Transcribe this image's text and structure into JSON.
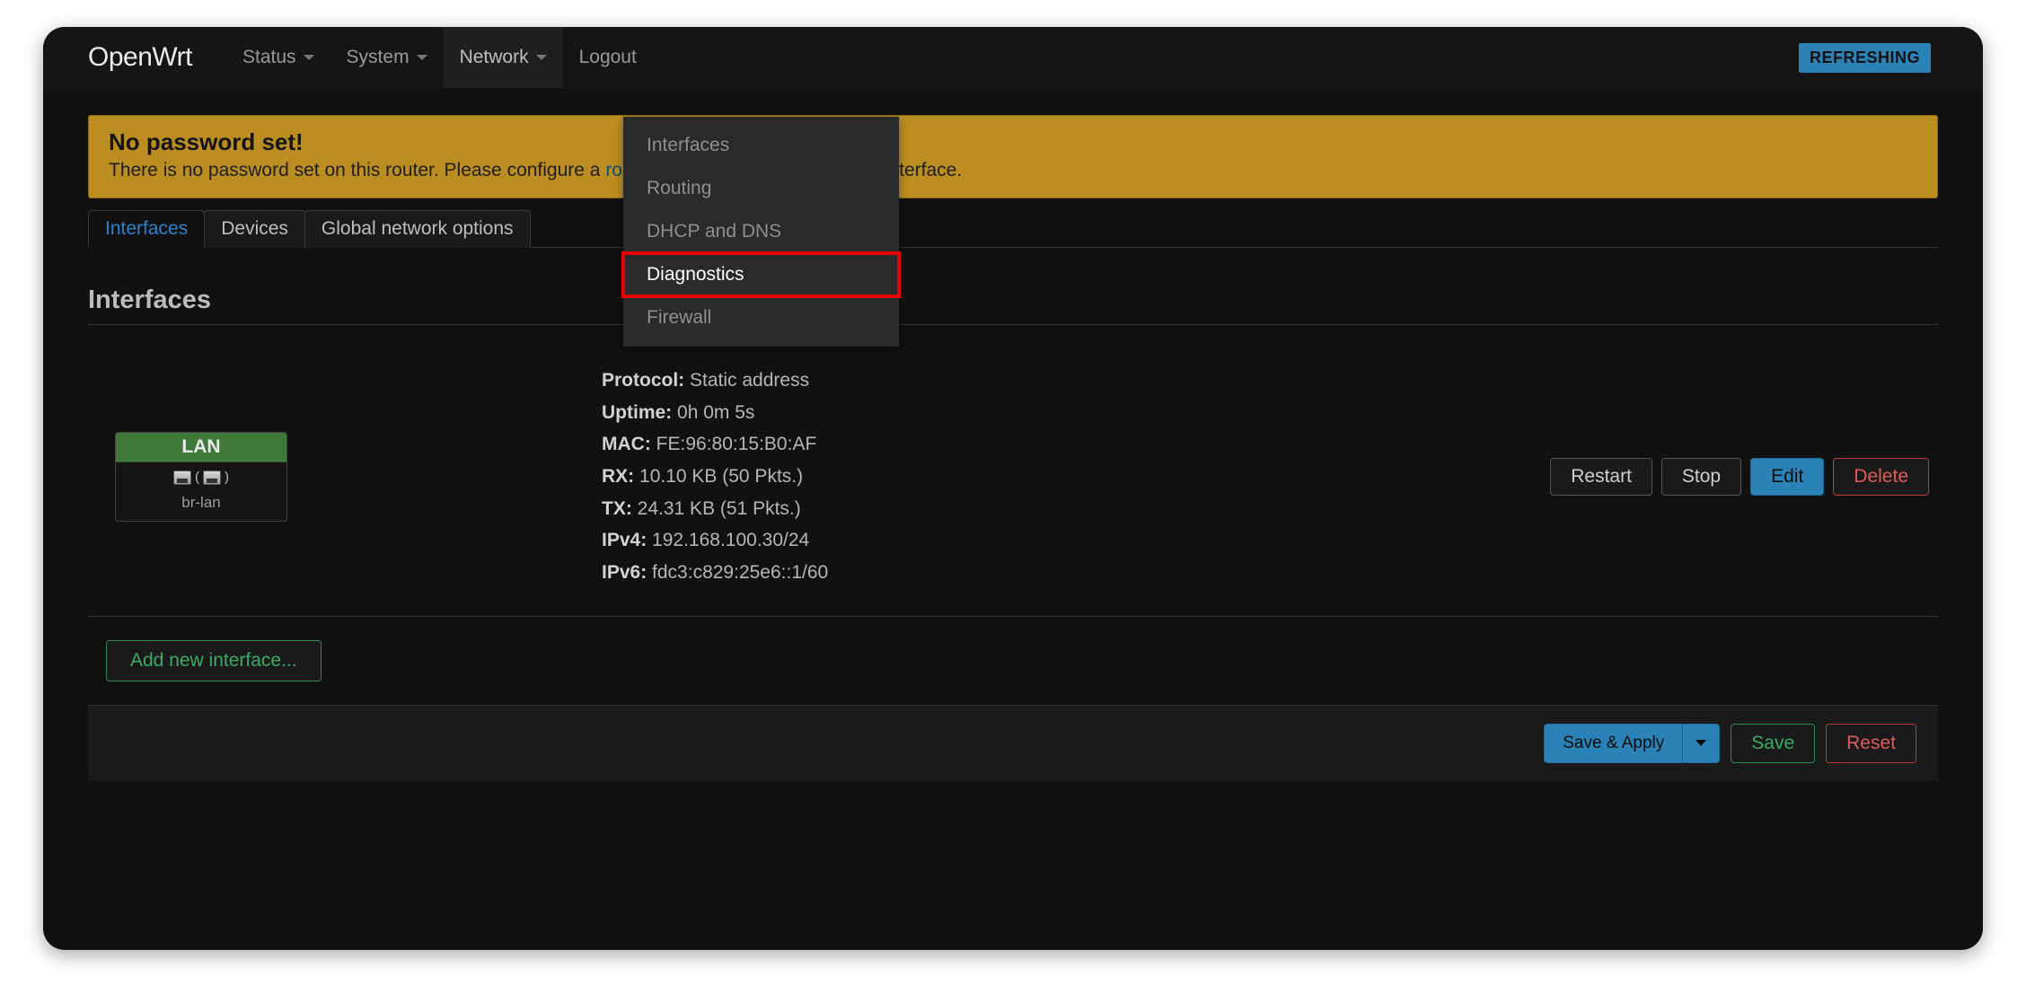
{
  "brand": "OpenWrt",
  "topnav": {
    "status": "Status",
    "system": "System",
    "network": "Network",
    "logout": "Logout"
  },
  "indicator": {
    "refreshing": "REFRESHING"
  },
  "network_menu": {
    "interfaces": "Interfaces",
    "routing": "Routing",
    "dhcp_dns": "DHCP and DNS",
    "diagnostics": "Diagnostics",
    "firewall": "Firewall"
  },
  "alert": {
    "title": "No password set!",
    "text_before": "There is no password set on this router. Please configure a ",
    "link": "root password",
    "text_after": " to protect the web interface."
  },
  "tabs": {
    "interfaces": "Interfaces",
    "devices": "Devices",
    "global": "Global network options"
  },
  "heading": "Interfaces",
  "iface": {
    "zone": "LAN",
    "device": "br-lan",
    "protocol_label": "Protocol:",
    "protocol": "Static address",
    "uptime_label": "Uptime:",
    "uptime": "0h 0m 5s",
    "mac_label": "MAC:",
    "mac": "FE:96:80:15:B0:AF",
    "rx_label": "RX:",
    "rx": "10.10 KB (50 Pkts.)",
    "tx_label": "TX:",
    "tx": "24.31 KB (51 Pkts.)",
    "ipv4_label": "IPv4:",
    "ipv4": "192.168.100.30/24",
    "ipv6_label": "IPv6:",
    "ipv6": "fdc3:c829:25e6::1/60"
  },
  "actions": {
    "restart": "Restart",
    "stop": "Stop",
    "edit": "Edit",
    "delete": "Delete",
    "add": "Add new interface...",
    "save_apply": "Save & Apply",
    "save": "Save",
    "reset": "Reset"
  }
}
